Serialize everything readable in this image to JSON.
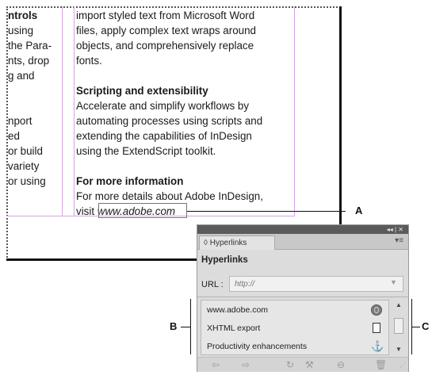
{
  "document": {
    "left_column_lines": [
      "ntrols",
      "using",
      "the Para-",
      "nts, drop",
      "g and",
      "",
      "",
      "nport",
      "ed",
      "or build",
      "variety",
      "or using"
    ],
    "right_column": {
      "intro_lines": [
        "import styled text from Microsoft Word",
        "files, apply complex text wraps around",
        "objects, and comprehensively replace",
        "fonts."
      ],
      "section1_heading": "Scripting and extensibility",
      "section1_lines": [
        "Accelerate and simplify workflows by",
        "automating processes using scripts and",
        "extending the capabilities of InDesign",
        "using the ExtendScript toolkit."
      ],
      "section2_heading": "For more information",
      "section2_line1": "For more details about Adobe InDesign,",
      "section2_visit": "visit ",
      "section2_url": "www.adobe.com"
    }
  },
  "callouts": {
    "a": "A",
    "b": "B",
    "c": "C"
  },
  "panel": {
    "titlebar_controls": "◂◂ | ✕",
    "tab_label": "◊ Hyperlinks",
    "menu_icon": "▾≡",
    "heading": "Hyperlinks",
    "url_label": "URL :",
    "url_placeholder": "http://",
    "links": [
      {
        "label": "www.adobe.com",
        "icon": "globe-icon"
      },
      {
        "label": "XHTML export",
        "icon": "page-icon"
      },
      {
        "label": "Productivity enhancements",
        "icon": "anchor-icon"
      }
    ],
    "toolbar": {
      "back": "⇦",
      "forward": "⇨",
      "refresh": "↻",
      "new_destination": "⚒",
      "new_hyperlink": "⊖",
      "delete": "🗑"
    }
  }
}
